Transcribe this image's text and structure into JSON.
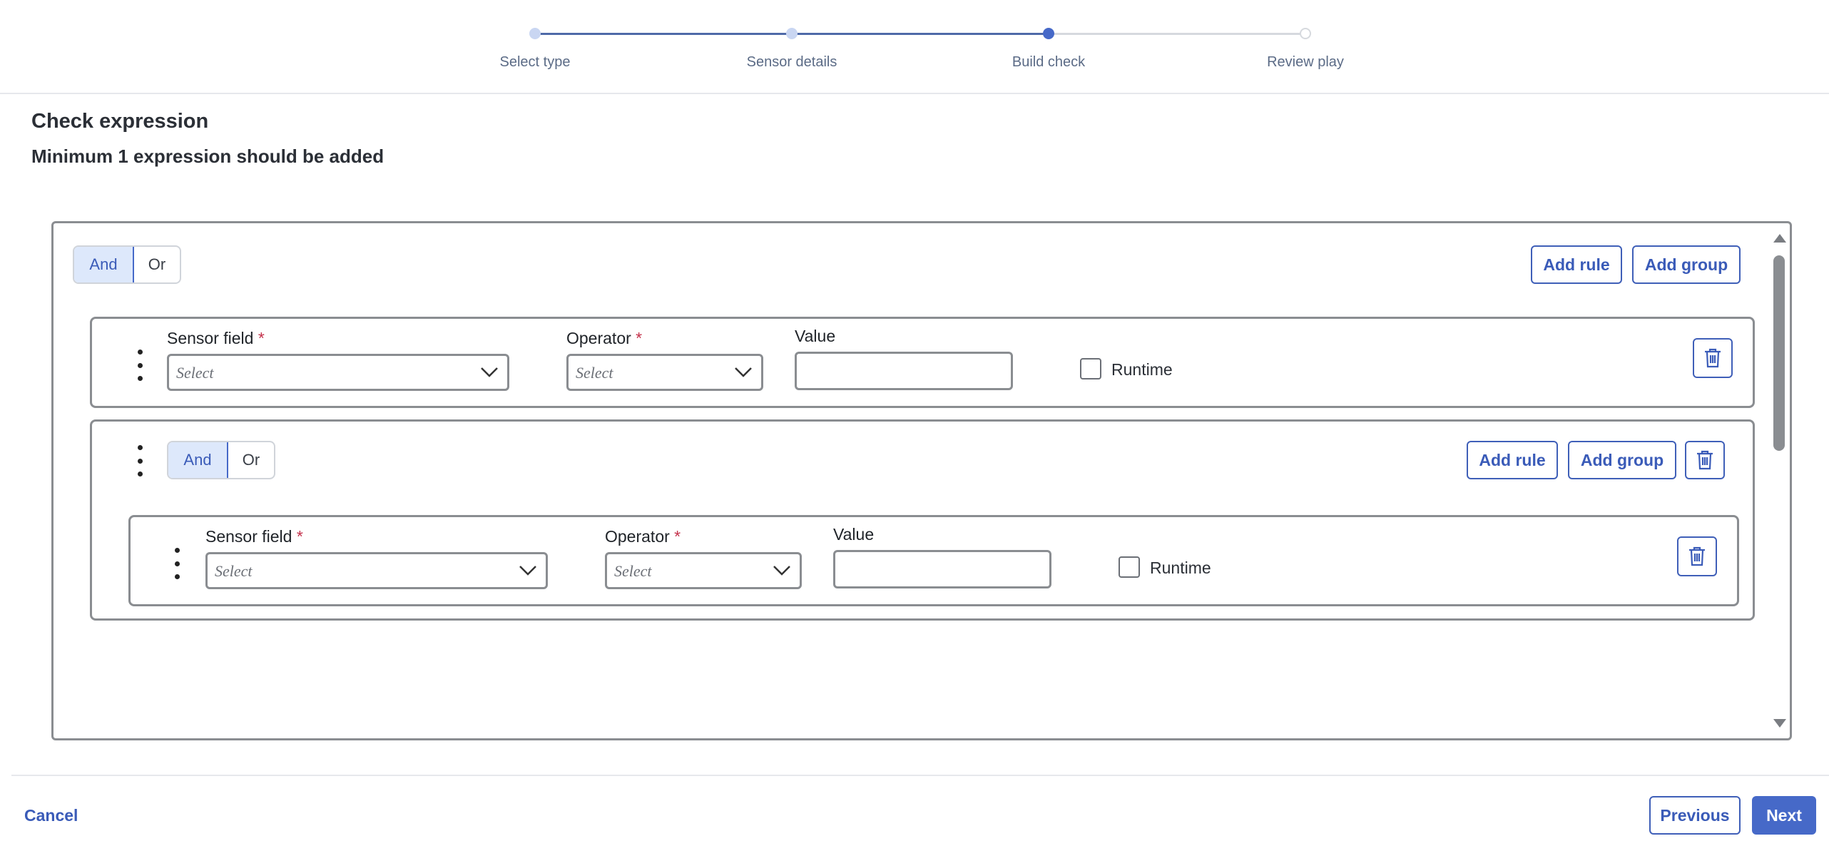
{
  "stepper": {
    "steps": [
      {
        "label": "Select type",
        "state": "done"
      },
      {
        "label": "Sensor details",
        "state": "done"
      },
      {
        "label": "Build check",
        "state": "active"
      },
      {
        "label": "Review play",
        "state": "pending"
      }
    ]
  },
  "header": {
    "title": "Check expression",
    "subtitle": "Minimum 1 expression should be added"
  },
  "root_group": {
    "and_label": "And",
    "or_label": "Or",
    "selected": "And",
    "add_rule_label": "Add rule",
    "add_group_label": "Add group",
    "rule": {
      "sensor_field_label": "Sensor field",
      "operator_label": "Operator",
      "value_label": "Value",
      "required_mark": "*",
      "sensor_field_placeholder": "Select",
      "operator_placeholder": "Select",
      "value": "",
      "runtime_label": "Runtime",
      "runtime_checked": false
    },
    "nested_group": {
      "and_label": "And",
      "or_label": "Or",
      "selected": "And",
      "add_rule_label": "Add rule",
      "add_group_label": "Add group",
      "rule": {
        "sensor_field_label": "Sensor field",
        "operator_label": "Operator",
        "value_label": "Value",
        "required_mark": "*",
        "sensor_field_placeholder": "Select",
        "operator_placeholder": "Select",
        "value": "",
        "runtime_label": "Runtime",
        "runtime_checked": false
      }
    }
  },
  "footer": {
    "cancel_label": "Cancel",
    "previous_label": "Previous",
    "next_label": "Next"
  },
  "colors": {
    "accent": "#4669c8",
    "accent_light": "#dde8fb",
    "step_done": "#c9d6f2",
    "required": "#c4314b"
  }
}
